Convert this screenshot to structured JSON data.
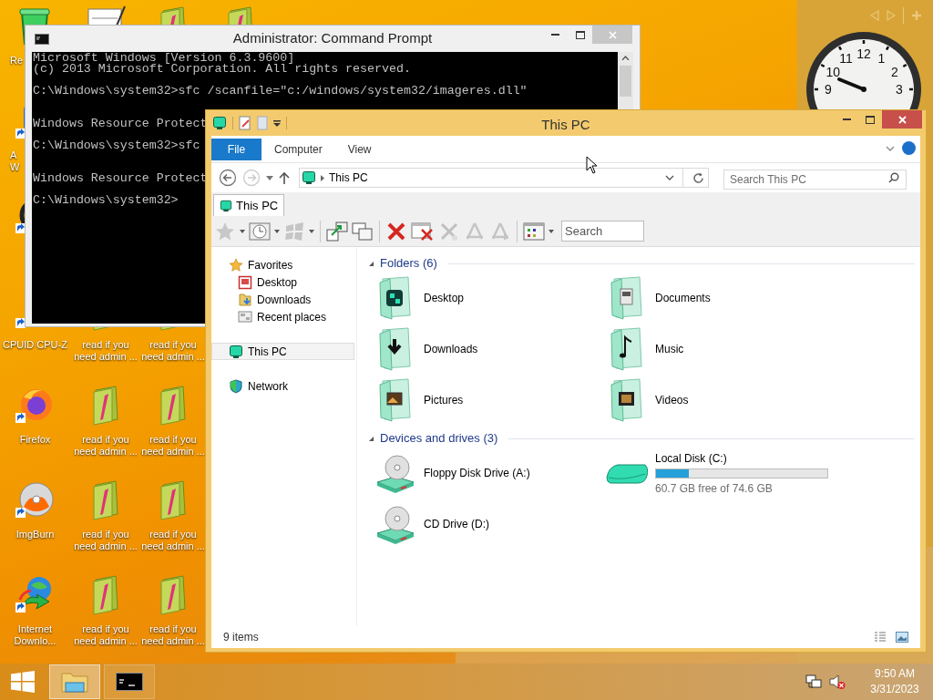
{
  "desktop_icons": [
    {
      "icons": [
        {
          "kind": "recycle",
          "lines": [
            "Re"
          ],
          "cut": true
        },
        {
          "kind": "app",
          "lines": [
            "A",
            "W"
          ],
          "cut": true
        },
        {
          "kind": "ring"
        },
        {
          "kind": "chip",
          "lines": [
            "CPUID CPU-Z"
          ]
        },
        {
          "kind": "firefox",
          "lines": [
            "Firefox"
          ]
        },
        {
          "kind": "disc",
          "lines": [
            "ImgBurn"
          ]
        },
        {
          "kind": "globe",
          "lines": [
            "Internet",
            "Downlo..."
          ]
        }
      ]
    },
    {
      "icons": [
        {
          "kind": "document"
        },
        {
          "kind": "folder",
          "lines": [
            "read if you",
            "need admin ..."
          ]
        },
        {
          "kind": "folder",
          "lines": [
            "read if you",
            "need admin ..."
          ]
        },
        {
          "kind": "folder",
          "lines": [
            "read if you",
            "need admin ..."
          ]
        },
        {
          "kind": "folder",
          "lines": [
            "read if you",
            "need admin ..."
          ]
        }
      ]
    },
    {
      "icons": [
        {
          "kind": "folder"
        },
        {
          "kind": "folder",
          "lines": [
            "read if you",
            "need admin ..."
          ]
        },
        {
          "kind": "folder",
          "lines": [
            "read if you",
            "need admin ..."
          ]
        },
        {
          "kind": "folder",
          "lines": [
            "read if you",
            "need admin ..."
          ]
        },
        {
          "kind": "folder",
          "lines": [
            "read if you",
            "need admin ..."
          ]
        }
      ]
    },
    {
      "icons": [
        {
          "kind": "folder"
        }
      ]
    }
  ],
  "clock": {
    "numerals": [
      "12",
      "11",
      "1",
      "10",
      "2",
      "9",
      "3"
    ]
  },
  "console": {
    "title": "Administrator: Command Prompt",
    "blocks": [
      {
        "kind": "output",
        "lines": [
          "Microsoft Windows [Version 6.3.9600]",
          "(c) 2013 Microsoft Corporation. All rights reserved."
        ]
      },
      {
        "kind": "command",
        "lines": [
          "C:\\Windows\\system32>sfc /scanfile=\"c:/windows/system32/imageres.dll\""
        ]
      },
      {
        "kind": "output",
        "lines": [
          "Windows Resource Protect"
        ]
      },
      {
        "kind": "command",
        "lines": [
          "C:\\Windows\\system32>sfc"
        ]
      },
      {
        "kind": "output",
        "lines": [
          "Windows Resource Protect"
        ]
      },
      {
        "kind": "prompt",
        "lines": [
          "C:\\Windows\\system32>"
        ]
      }
    ]
  },
  "explorer": {
    "title": "This PC",
    "ribbon_tabs": [
      {
        "label": "File",
        "kind": "file"
      },
      {
        "label": "Computer",
        "kind": "tab"
      },
      {
        "label": "View",
        "kind": "tab"
      }
    ],
    "address": {
      "crumbs": [
        "This PC"
      ]
    },
    "search": {
      "placeholder": "Search This PC"
    },
    "tabs": [
      {
        "label": "This PC",
        "selected": true
      }
    ],
    "toolbar_search": {
      "placeholder": "Search"
    },
    "nav": [
      {
        "label": "Favorites",
        "kind": "star",
        "selected": false,
        "children": [
          {
            "label": "Desktop",
            "kind": "desktop",
            "selected": false
          },
          {
            "label": "Downloads",
            "kind": "downloads",
            "selected": false
          },
          {
            "label": "Recent places",
            "kind": "recent",
            "selected": false
          }
        ]
      },
      {
        "label": "This PC",
        "kind": "pc",
        "selected": true
      },
      {
        "label": "Network",
        "kind": "network",
        "selected": false
      }
    ],
    "groups": [
      {
        "title": "Folders (6)",
        "expanded": true,
        "items": [
          {
            "name": "Desktop",
            "kind": "desktop"
          },
          {
            "name": "Documents",
            "kind": "documents"
          },
          {
            "name": "Downloads",
            "kind": "downloads"
          },
          {
            "name": "Music",
            "kind": "music"
          },
          {
            "name": "Pictures",
            "kind": "pictures"
          },
          {
            "name": "Videos",
            "kind": "videos"
          }
        ]
      },
      {
        "title": "Devices and drives (3)",
        "expanded": true,
        "items": [
          {
            "name": "Floppy Disk Drive (A:)",
            "kind": "floppy"
          },
          {
            "name": "Local Disk (C:)",
            "kind": "disk",
            "level": 0.19,
            "detail": "60.7 GB free of 74.6 GB"
          },
          {
            "name": "CD Drive (D:)",
            "kind": "cd"
          }
        ]
      }
    ],
    "status": "9 items"
  },
  "taskbar": {
    "apps": [
      {
        "kind": "explorer",
        "selected": true
      },
      {
        "kind": "console",
        "selected": false
      }
    ],
    "volume_muted": true,
    "time": "9:50 AM",
    "date": "3/31/2023"
  }
}
